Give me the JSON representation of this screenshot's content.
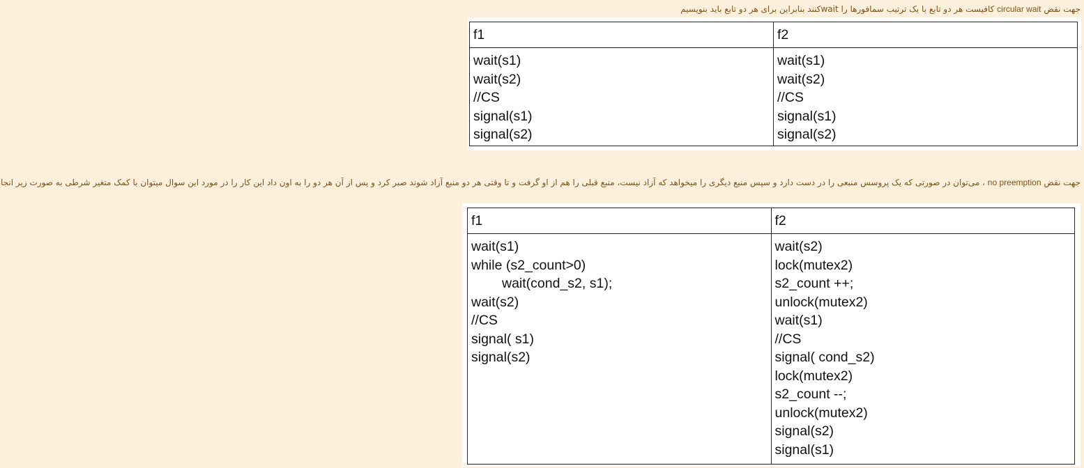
{
  "para1": {
    "prefix": "جهت نقض ",
    "term": "circular wait",
    "rest": "  کافیست هر دو تابع با یک ترتیب سمافورها را waitکنند بنابراین برای هر دو تابع باید بنویسیم"
  },
  "table1": {
    "headers": [
      "f1",
      "f2"
    ],
    "f1": [
      "wait(s1)",
      "wait(s2)",
      "//CS",
      "signal(s1)",
      "signal(s2)"
    ],
    "f2": [
      "wait(s1)",
      "wait(s2)",
      "//CS",
      "signal(s1)",
      "signal(s2)"
    ]
  },
  "para2": {
    "prefix": "جهت نقض ",
    "term": "no preemption",
    "rest": " ، می‌توان در صورتی که یک پروسس منبعی را در دست دارد و سپس منبع دیگری را میخواهد که آزاد نیست، منبع قبلی را هم از او گرفت و تا وقتی هر دو منبع آزاد شوند صبر کرد و پس از آن هر دو را به اون داد این کار را در مورد این سوال میتوان با کمک متغیر شرطی به صورت زیر انجام داد."
  },
  "table2": {
    "headers": [
      "f1",
      "f2"
    ],
    "f1": [
      "wait(s1)",
      "while (s2_count>0)",
      "wait(cond_s2, s1);",
      "wait(s2)",
      "//CS",
      "signal( s1)",
      "signal(s2)"
    ],
    "f2": [
      "wait(s2)",
      "lock(mutex2)",
      "s2_count ++;",
      "unlock(mutex2)",
      "wait(s1)",
      "//CS",
      "signal( cond_s2)",
      "lock(mutex2)",
      "s2_count --;",
      "unlock(mutex2)",
      "signal(s2)",
      "signal(s1)"
    ]
  }
}
